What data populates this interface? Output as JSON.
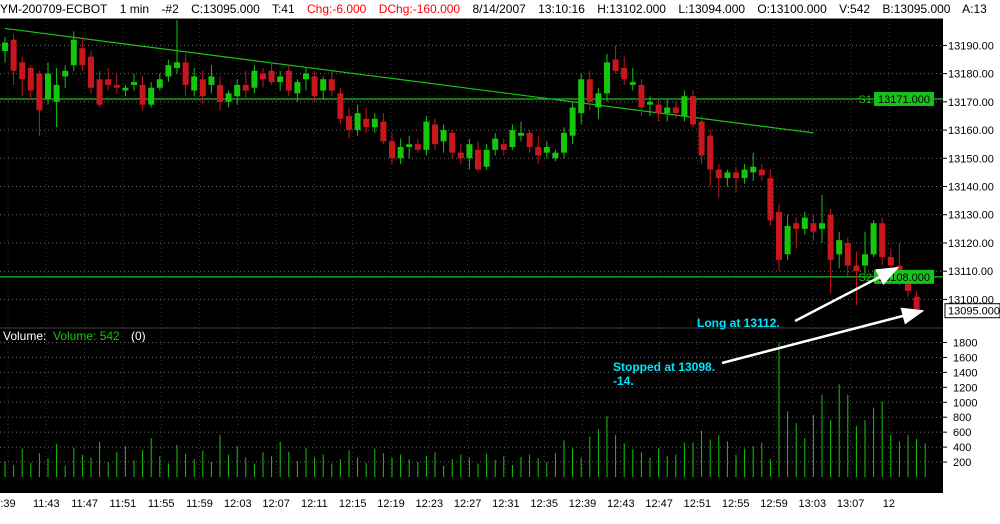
{
  "header": {
    "symbol": "YM-200709-ECBOT",
    "interval": "1 min",
    "chart_id": "-#2",
    "close": "C:13095.000",
    "ticks": "T:41",
    "change": "Chg:-6.000",
    "day_change": "DChg:-160.000",
    "date": "8/14/2007",
    "time": "13:10:16",
    "high": "H:13102.000",
    "low": "L:13094.000",
    "open": "O:13100.000",
    "volume": "V:542",
    "bid": "B:13095.000",
    "ask": "A:13"
  },
  "colors": {
    "up": "#16c60c",
    "down": "#c8161d",
    "grid": "#6a6a6a",
    "line": "#19c219",
    "annotation": "#00e5ff",
    "background": "#000000"
  },
  "price_panel": {
    "levels": [
      {
        "label": "S1",
        "value": 13171
      },
      {
        "label": "S2",
        "value": 13108
      }
    ],
    "last_price_label": "13095.000",
    "annotations": [
      {
        "text": "Long at 13112."
      },
      {
        "lines": [
          "Stopped at 13098.",
          "-14."
        ]
      }
    ]
  },
  "volume_panel": {
    "title": "Volume:",
    "series_label": "Volume: 542",
    "extra": "(0)"
  },
  "chart_data": [
    {
      "type": "candlestick",
      "x_labels": [
        ":39",
        "11:43",
        "11:47",
        "11:51",
        "11:55",
        "11:59",
        "12:03",
        "12:07",
        "12:11",
        "12:15",
        "12:19",
        "12:23",
        "12:27",
        "12:31",
        "12:35",
        "12:39",
        "12:43",
        "12:47",
        "12:51",
        "12:55",
        "12:59",
        "13:03",
        "13:07",
        "12"
      ],
      "y_ticks": [
        13100,
        13110,
        13120,
        13130,
        13140,
        13150,
        13160,
        13170,
        13180,
        13190
      ],
      "ylim": [
        13092,
        13199
      ],
      "trendline": [
        {
          "x_bar": 0,
          "y": 13196
        },
        {
          "x_bar": 94,
          "y": 13159
        }
      ],
      "candles": [
        {
          "o": 13188,
          "h": 13193,
          "l": 13184,
          "c": 13191
        },
        {
          "o": 13192,
          "h": 13194,
          "l": 13176,
          "c": 13181
        },
        {
          "o": 13184,
          "h": 13186,
          "l": 13172,
          "c": 13178
        },
        {
          "o": 13182,
          "h": 13183,
          "l": 13171,
          "c": 13174
        },
        {
          "o": 13180,
          "h": 13181,
          "l": 13158,
          "c": 13167
        },
        {
          "o": 13171,
          "h": 13184,
          "l": 13169,
          "c": 13180
        },
        {
          "o": 13170,
          "h": 13182,
          "l": 13161,
          "c": 13176
        },
        {
          "o": 13179,
          "h": 13183,
          "l": 13175,
          "c": 13181
        },
        {
          "o": 13183,
          "h": 13195,
          "l": 13181,
          "c": 13192
        },
        {
          "o": 13189,
          "h": 13193,
          "l": 13181,
          "c": 13183
        },
        {
          "o": 13186,
          "h": 13188,
          "l": 13173,
          "c": 13175
        },
        {
          "o": 13178,
          "h": 13181,
          "l": 13168,
          "c": 13169
        },
        {
          "o": 13178,
          "h": 13182,
          "l": 13174,
          "c": 13176
        },
        {
          "o": 13176,
          "h": 13180,
          "l": 13173,
          "c": 13175
        },
        {
          "o": 13174,
          "h": 13176,
          "l": 13172,
          "c": 13175
        },
        {
          "o": 13176,
          "h": 13180,
          "l": 13174,
          "c": 13177
        },
        {
          "o": 13176,
          "h": 13179,
          "l": 13167,
          "c": 13169
        },
        {
          "o": 13169,
          "h": 13177,
          "l": 13168,
          "c": 13175
        },
        {
          "o": 13175,
          "h": 13180,
          "l": 13174,
          "c": 13178
        },
        {
          "o": 13179,
          "h": 13185,
          "l": 13177,
          "c": 13183
        },
        {
          "o": 13182,
          "h": 13199,
          "l": 13180,
          "c": 13184
        },
        {
          "o": 13184,
          "h": 13187,
          "l": 13172,
          "c": 13176
        },
        {
          "o": 13174,
          "h": 13182,
          "l": 13172,
          "c": 13179
        },
        {
          "o": 13178,
          "h": 13181,
          "l": 13169,
          "c": 13172
        },
        {
          "o": 13176,
          "h": 13183,
          "l": 13173,
          "c": 13179
        },
        {
          "o": 13176,
          "h": 13179,
          "l": 13167,
          "c": 13170
        },
        {
          "o": 13170,
          "h": 13174,
          "l": 13168,
          "c": 13173
        },
        {
          "o": 13172,
          "h": 13178,
          "l": 13169,
          "c": 13176
        },
        {
          "o": 13176,
          "h": 13181,
          "l": 13171,
          "c": 13174
        },
        {
          "o": 13175,
          "h": 13183,
          "l": 13173,
          "c": 13181
        },
        {
          "o": 13180,
          "h": 13182,
          "l": 13175,
          "c": 13178
        },
        {
          "o": 13181,
          "h": 13184,
          "l": 13176,
          "c": 13177
        },
        {
          "o": 13177,
          "h": 13181,
          "l": 13174,
          "c": 13179
        },
        {
          "o": 13181,
          "h": 13183,
          "l": 13172,
          "c": 13174
        },
        {
          "o": 13173,
          "h": 13178,
          "l": 13170,
          "c": 13177
        },
        {
          "o": 13178,
          "h": 13182,
          "l": 13174,
          "c": 13180
        },
        {
          "o": 13179,
          "h": 13181,
          "l": 13170,
          "c": 13172
        },
        {
          "o": 13174,
          "h": 13179,
          "l": 13171,
          "c": 13178
        },
        {
          "o": 13178,
          "h": 13181,
          "l": 13172,
          "c": 13174
        },
        {
          "o": 13173,
          "h": 13175,
          "l": 13162,
          "c": 13164
        },
        {
          "o": 13165,
          "h": 13168,
          "l": 13157,
          "c": 13160
        },
        {
          "o": 13160,
          "h": 13169,
          "l": 13158,
          "c": 13166
        },
        {
          "o": 13164,
          "h": 13168,
          "l": 13159,
          "c": 13161
        },
        {
          "o": 13161,
          "h": 13166,
          "l": 13159,
          "c": 13164
        },
        {
          "o": 13163,
          "h": 13166,
          "l": 13155,
          "c": 13156
        },
        {
          "o": 13156,
          "h": 13159,
          "l": 13148,
          "c": 13150
        },
        {
          "o": 13150,
          "h": 13157,
          "l": 13148,
          "c": 13154
        },
        {
          "o": 13154,
          "h": 13158,
          "l": 13150,
          "c": 13155
        },
        {
          "o": 13155,
          "h": 13157,
          "l": 13152,
          "c": 13153
        },
        {
          "o": 13153,
          "h": 13165,
          "l": 13151,
          "c": 13163
        },
        {
          "o": 13162,
          "h": 13164,
          "l": 13153,
          "c": 13155
        },
        {
          "o": 13156,
          "h": 13162,
          "l": 13152,
          "c": 13160
        },
        {
          "o": 13159,
          "h": 13160,
          "l": 13150,
          "c": 13152
        },
        {
          "o": 13152,
          "h": 13155,
          "l": 13148,
          "c": 13150
        },
        {
          "o": 13150,
          "h": 13157,
          "l": 13146,
          "c": 13155
        },
        {
          "o": 13153,
          "h": 13156,
          "l": 13145,
          "c": 13146
        },
        {
          "o": 13147,
          "h": 13155,
          "l": 13146,
          "c": 13153
        },
        {
          "o": 13153,
          "h": 13159,
          "l": 13151,
          "c": 13157
        },
        {
          "o": 13155,
          "h": 13157,
          "l": 13151,
          "c": 13153
        },
        {
          "o": 13154,
          "h": 13162,
          "l": 13153,
          "c": 13160
        },
        {
          "o": 13158,
          "h": 13163,
          "l": 13156,
          "c": 13159
        },
        {
          "o": 13159,
          "h": 13160,
          "l": 13152,
          "c": 13154
        },
        {
          "o": 13154,
          "h": 13158,
          "l": 13148,
          "c": 13151
        },
        {
          "o": 13152,
          "h": 13156,
          "l": 13150,
          "c": 13154
        },
        {
          "o": 13150,
          "h": 13153,
          "l": 13149,
          "c": 13152
        },
        {
          "o": 13152,
          "h": 13161,
          "l": 13150,
          "c": 13159
        },
        {
          "o": 13158,
          "h": 13170,
          "l": 13155,
          "c": 13168
        },
        {
          "o": 13166,
          "h": 13180,
          "l": 13162,
          "c": 13178
        },
        {
          "o": 13178,
          "h": 13181,
          "l": 13167,
          "c": 13170
        },
        {
          "o": 13168,
          "h": 13175,
          "l": 13164,
          "c": 13173
        },
        {
          "o": 13173,
          "h": 13187,
          "l": 13170,
          "c": 13184
        },
        {
          "o": 13185,
          "h": 13190,
          "l": 13180,
          "c": 13181
        },
        {
          "o": 13182,
          "h": 13186,
          "l": 13176,
          "c": 13178
        },
        {
          "o": 13176,
          "h": 13182,
          "l": 13174,
          "c": 13177
        },
        {
          "o": 13176,
          "h": 13178,
          "l": 13165,
          "c": 13168
        },
        {
          "o": 13169,
          "h": 13172,
          "l": 13165,
          "c": 13170
        },
        {
          "o": 13169,
          "h": 13171,
          "l": 13163,
          "c": 13166
        },
        {
          "o": 13166,
          "h": 13171,
          "l": 13163,
          "c": 13168
        },
        {
          "o": 13168,
          "h": 13170,
          "l": 13164,
          "c": 13166
        },
        {
          "o": 13165,
          "h": 13174,
          "l": 13163,
          "c": 13172
        },
        {
          "o": 13172,
          "h": 13174,
          "l": 13161,
          "c": 13162
        },
        {
          "o": 13163,
          "h": 13165,
          "l": 13148,
          "c": 13151
        },
        {
          "o": 13158,
          "h": 13160,
          "l": 13140,
          "c": 13146
        },
        {
          "o": 13146,
          "h": 13148,
          "l": 13136,
          "c": 13143
        },
        {
          "o": 13143,
          "h": 13146,
          "l": 13140,
          "c": 13145
        },
        {
          "o": 13145,
          "h": 13147,
          "l": 13138,
          "c": 13143
        },
        {
          "o": 13143,
          "h": 13148,
          "l": 13141,
          "c": 13146
        },
        {
          "o": 13145,
          "h": 13152,
          "l": 13142,
          "c": 13147
        },
        {
          "o": 13146,
          "h": 13148,
          "l": 13142,
          "c": 13144
        },
        {
          "o": 13143,
          "h": 13146,
          "l": 13126,
          "c": 13128
        },
        {
          "o": 13131,
          "h": 13134,
          "l": 13110,
          "c": 13114
        },
        {
          "o": 13116,
          "h": 13130,
          "l": 13114,
          "c": 13126
        },
        {
          "o": 13127,
          "h": 13129,
          "l": 13118,
          "c": 13125
        },
        {
          "o": 13125,
          "h": 13131,
          "l": 13123,
          "c": 13129
        },
        {
          "o": 13127,
          "h": 13130,
          "l": 13121,
          "c": 13124
        },
        {
          "o": 13125,
          "h": 13137,
          "l": 13120,
          "c": 13127
        },
        {
          "o": 13130,
          "h": 13132,
          "l": 13102,
          "c": 13114
        },
        {
          "o": 13116,
          "h": 13124,
          "l": 13111,
          "c": 13121
        },
        {
          "o": 13120,
          "h": 13122,
          "l": 13108,
          "c": 13112
        },
        {
          "o": 13112,
          "h": 13117,
          "l": 13098,
          "c": 13110
        },
        {
          "o": 13112,
          "h": 13124,
          "l": 13109,
          "c": 13116
        },
        {
          "o": 13116,
          "h": 13128,
          "l": 13115,
          "c": 13127
        },
        {
          "o": 13127,
          "h": 13129,
          "l": 13112,
          "c": 13115
        },
        {
          "o": 13115,
          "h": 13118,
          "l": 13110,
          "c": 13112
        },
        {
          "o": 13112,
          "h": 13120,
          "l": 13105,
          "c": 13108
        },
        {
          "o": 13107,
          "h": 13109,
          "l": 13101,
          "c": 13103
        },
        {
          "o": 13101,
          "h": 13103,
          "l": 13095,
          "c": 13096
        }
      ]
    },
    {
      "type": "bar",
      "name": "Volume",
      "y_ticks": [
        200,
        400,
        600,
        800,
        1000,
        1200,
        1400,
        1600,
        1800
      ],
      "ylim": [
        0,
        1900
      ],
      "values": [
        210,
        160,
        380,
        190,
        320,
        250,
        440,
        150,
        390,
        300,
        260,
        470,
        200,
        330,
        410,
        220,
        360,
        520,
        280,
        180,
        430,
        310,
        240,
        350,
        200,
        560,
        300,
        410,
        260,
        180,
        330,
        280,
        470,
        340,
        210,
        390,
        260,
        300,
        180,
        240,
        360,
        260,
        190,
        380,
        320,
        260,
        300,
        240,
        200,
        280,
        330,
        150,
        240,
        300,
        260,
        180,
        310,
        230,
        280,
        160,
        270,
        300,
        250,
        200,
        320,
        490,
        380,
        260,
        540,
        640,
        820,
        560,
        450,
        370,
        330,
        260,
        380,
        280,
        300,
        460,
        460,
        620,
        500,
        560,
        480,
        300,
        380,
        410,
        460,
        240,
        1800,
        880,
        720,
        520,
        830,
        1100,
        760,
        1240,
        1100,
        680,
        760,
        930,
        1010,
        560,
        480,
        560,
        510,
        450
      ]
    }
  ]
}
